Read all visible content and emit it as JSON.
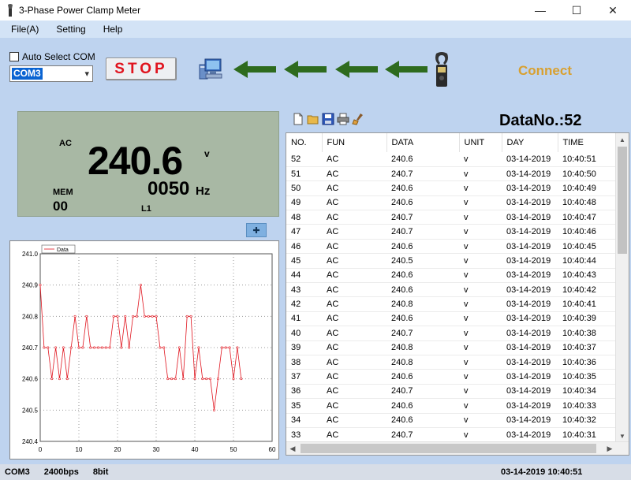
{
  "window": {
    "title": "3-Phase Power Clamp Meter",
    "minimize": "—",
    "maximize": "☐",
    "close": "✕"
  },
  "menu": [
    "File(A)",
    "Setting",
    "Help"
  ],
  "controls": {
    "auto_select_label": "Auto Select COM",
    "com_value": "COM3",
    "stop_label": "STOP",
    "connect_label": "Connect"
  },
  "colors": {
    "arrow": "#2e6b1e",
    "connect": "#d8a030",
    "stop_text": "#e0141e",
    "lcd_bg": "#a8b8a4",
    "trace": "#e0141e"
  },
  "icons": [
    "pc-icon",
    "arrow-left-icon",
    "clamp-meter-icon",
    "new-file-icon",
    "open-folder-icon",
    "save-icon",
    "print-icon",
    "clear-icon",
    "zoom-icon"
  ],
  "lcd": {
    "mode": "AC",
    "value": "240.6",
    "unit": "v",
    "mem_label": "MEM",
    "mem_value": "00",
    "freq": "0050",
    "freq_unit": "Hz",
    "phase": "L1"
  },
  "datano": "DataNo.:52",
  "table": {
    "headers": [
      "NO.",
      "FUN",
      "DATA",
      "UNIT",
      "DAY",
      "TIME"
    ],
    "rows": [
      [
        "52",
        "AC",
        "240.6",
        "v",
        "03-14-2019",
        "10:40:51"
      ],
      [
        "51",
        "AC",
        "240.7",
        "v",
        "03-14-2019",
        "10:40:50"
      ],
      [
        "50",
        "AC",
        "240.6",
        "v",
        "03-14-2019",
        "10:40:49"
      ],
      [
        "49",
        "AC",
        "240.6",
        "v",
        "03-14-2019",
        "10:40:48"
      ],
      [
        "48",
        "AC",
        "240.7",
        "v",
        "03-14-2019",
        "10:40:47"
      ],
      [
        "47",
        "AC",
        "240.7",
        "v",
        "03-14-2019",
        "10:40:46"
      ],
      [
        "46",
        "AC",
        "240.6",
        "v",
        "03-14-2019",
        "10:40:45"
      ],
      [
        "45",
        "AC",
        "240.5",
        "v",
        "03-14-2019",
        "10:40:44"
      ],
      [
        "44",
        "AC",
        "240.6",
        "v",
        "03-14-2019",
        "10:40:43"
      ],
      [
        "43",
        "AC",
        "240.6",
        "v",
        "03-14-2019",
        "10:40:42"
      ],
      [
        "42",
        "AC",
        "240.8",
        "v",
        "03-14-2019",
        "10:40:41"
      ],
      [
        "41",
        "AC",
        "240.6",
        "v",
        "03-14-2019",
        "10:40:39"
      ],
      [
        "40",
        "AC",
        "240.7",
        "v",
        "03-14-2019",
        "10:40:38"
      ],
      [
        "39",
        "AC",
        "240.8",
        "v",
        "03-14-2019",
        "10:40:37"
      ],
      [
        "38",
        "AC",
        "240.8",
        "v",
        "03-14-2019",
        "10:40:36"
      ],
      [
        "37",
        "AC",
        "240.6",
        "v",
        "03-14-2019",
        "10:40:35"
      ],
      [
        "36",
        "AC",
        "240.7",
        "v",
        "03-14-2019",
        "10:40:34"
      ],
      [
        "35",
        "AC",
        "240.6",
        "v",
        "03-14-2019",
        "10:40:33"
      ],
      [
        "34",
        "AC",
        "240.6",
        "v",
        "03-14-2019",
        "10:40:32"
      ],
      [
        "33",
        "AC",
        "240.7",
        "v",
        "03-14-2019",
        "10:40:31"
      ]
    ]
  },
  "status": {
    "port": "COM3",
    "baud": "2400bps",
    "bits": "8bit",
    "datetime": "03-14-2019 10:40:51"
  },
  "chart_data": {
    "type": "line",
    "legend": "Data",
    "legend_position": "top-left",
    "grid": true,
    "xlim": [
      0,
      60
    ],
    "ylim": [
      240.4,
      241.0
    ],
    "xticks": [
      0,
      10,
      20,
      30,
      40,
      50,
      60
    ],
    "yticks": [
      240.4,
      240.5,
      240.6,
      240.7,
      240.8,
      240.9,
      241.0
    ],
    "series": [
      {
        "name": "Data",
        "x": [
          0,
          1,
          2,
          3,
          4,
          5,
          6,
          7,
          8,
          9,
          10,
          11,
          12,
          13,
          14,
          15,
          16,
          17,
          18,
          19,
          20,
          21,
          22,
          23,
          24,
          25,
          26,
          27,
          28,
          29,
          30,
          31,
          32,
          33,
          34,
          35,
          36,
          37,
          38,
          39,
          40,
          41,
          42,
          43,
          44,
          45,
          46,
          47,
          48,
          49,
          50,
          51,
          52
        ],
        "values": [
          240.9,
          240.7,
          240.7,
          240.6,
          240.7,
          240.6,
          240.7,
          240.6,
          240.7,
          240.8,
          240.7,
          240.7,
          240.8,
          240.7,
          240.7,
          240.7,
          240.7,
          240.7,
          240.7,
          240.8,
          240.8,
          240.7,
          240.8,
          240.7,
          240.8,
          240.8,
          240.9,
          240.8,
          240.8,
          240.8,
          240.8,
          240.7,
          240.7,
          240.6,
          240.6,
          240.6,
          240.7,
          240.6,
          240.8,
          240.8,
          240.6,
          240.7,
          240.6,
          240.6,
          240.6,
          240.5,
          240.6,
          240.7,
          240.7,
          240.7,
          240.6,
          240.7,
          240.6
        ]
      }
    ]
  }
}
